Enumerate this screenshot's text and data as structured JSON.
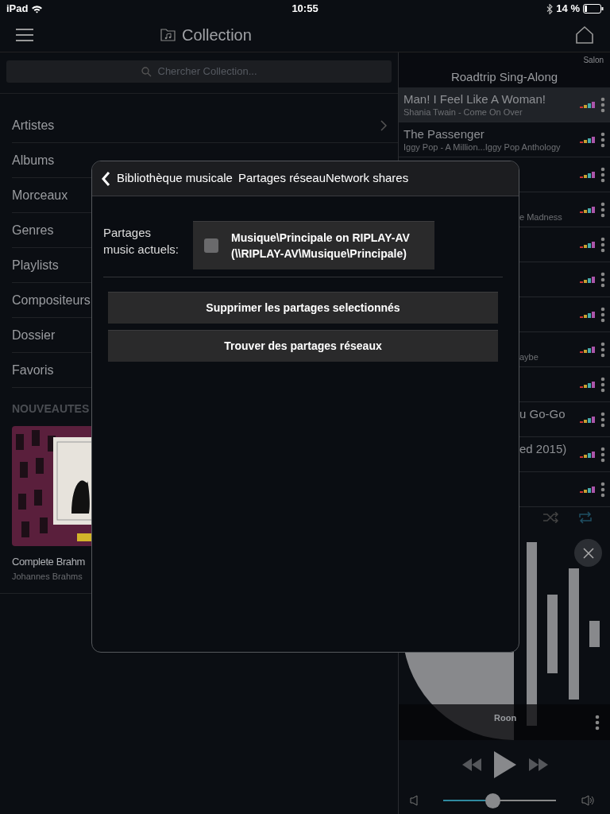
{
  "status_bar": {
    "device": "iPad",
    "time": "10:55",
    "battery": "14 %"
  },
  "top_bar": {
    "title": "Collection"
  },
  "search": {
    "placeholder": "Chercher Collection..."
  },
  "menu": [
    {
      "label": "Artistes"
    },
    {
      "label": "Albums"
    },
    {
      "label": "Morceaux"
    },
    {
      "label": "Genres"
    },
    {
      "label": "Playlists"
    },
    {
      "label": "Compositeurs"
    },
    {
      "label": "Dossier"
    },
    {
      "label": "Favoris"
    }
  ],
  "section_title": "NOUVEAUTES",
  "new_albums": [
    {
      "title": "Complete Brahm",
      "artist": "Johannes Brahms",
      "kind": "picture"
    }
  ],
  "queue": {
    "zone": "Salon",
    "playlist": "Roadtrip Sing-Along",
    "tracks": [
      {
        "title": "Man! I Feel Like A Woman!",
        "subtitle": "Shania Twain - Come On Over",
        "selected": true
      },
      {
        "title": "The Passenger",
        "subtitle": "Iggy Pop - A Million...Iggy Pop Anthology",
        "selected": false
      },
      {
        "selected": false
      },
      {
        "subtitle": "e Madness",
        "selected": false
      },
      {
        "selected": false
      },
      {
        "selected": false
      },
      {
        "selected": false
      },
      {
        "subtitle": "aybe",
        "selected": false
      },
      {
        "selected": false
      },
      {
        "title": "u Go-Go",
        "selected": false
      },
      {
        "title": "ed 2015)",
        "selected": false
      },
      {
        "selected": false
      }
    ]
  },
  "player": {
    "shuffle": false,
    "repeat": true,
    "zone_label": "Roon",
    "volume": {
      "level": 0.44
    }
  },
  "dialog": {
    "back": "Bibliothèque musicale",
    "title": "Partages réseauNetwork shares",
    "field_label": "Partages music actuels:",
    "shares": [
      {
        "lines": [
          "Musique\\Principale on RIPLAY-AV",
          "(\\\\RIPLAY-AV\\Musique\\Principale)"
        ],
        "checked": false
      }
    ],
    "buttons": [
      "Supprimer les partages selectionnés",
      "Trouver des partages réseaux"
    ]
  }
}
